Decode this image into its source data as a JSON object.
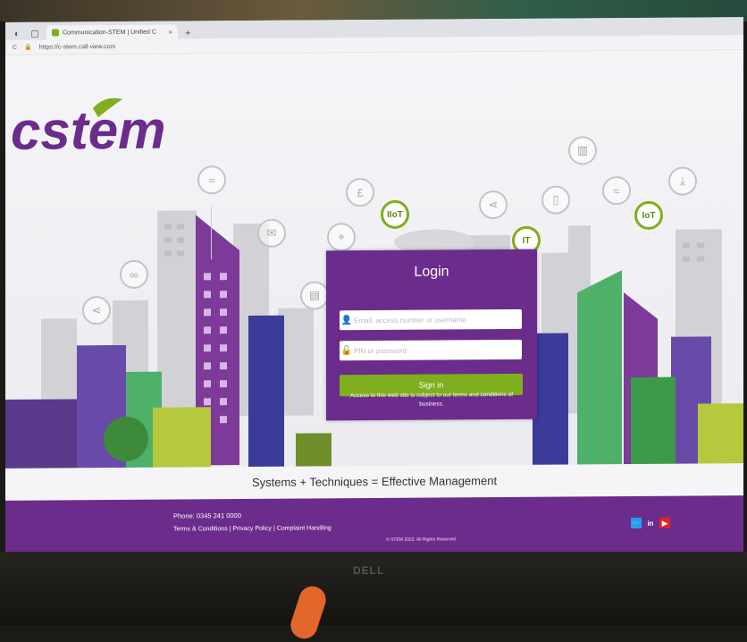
{
  "browser": {
    "tab_title": "Communication-STEM | Unified C",
    "tab_close": "×",
    "new_tab": "+",
    "url": "https://c-stem.call-view.com"
  },
  "brand": {
    "logo_text": "cstem",
    "purple": "#6c2c8c",
    "green": "#7fae1e"
  },
  "hero": {
    "tags": [
      "IIoT",
      "IT",
      "IoT"
    ],
    "bubble_icons": [
      "wifi-icon",
      "mail-icon",
      "pound-icon",
      "location-icon",
      "share-icon",
      "phone-icon",
      "chart-icon",
      "link-icon",
      "chat-icon"
    ]
  },
  "login": {
    "title": "Login",
    "username_placeholder": "Email, access number or username",
    "password_placeholder": "PIN or password",
    "signin_label": "Sign in",
    "terms_text": "Access to this web site is subject to our terms and conditions of business."
  },
  "tagline": "Systems + Techniques = Effective Management",
  "footer": {
    "phone": "Phone: 0345 241 0000",
    "links": [
      "Terms & Conditions",
      "Privacy Policy",
      "Complaint Handling"
    ],
    "copyright": "© STEM 2022. All Rights Reserved",
    "social": [
      {
        "name": "twitter-icon",
        "glyph": "🐦",
        "color": "#1da1f2"
      },
      {
        "name": "linkedin-icon",
        "glyph": "in",
        "color": "#0a66c2"
      },
      {
        "name": "youtube-icon",
        "glyph": "▶",
        "color": "#e02424"
      }
    ]
  },
  "monitor_brand": "DELL"
}
